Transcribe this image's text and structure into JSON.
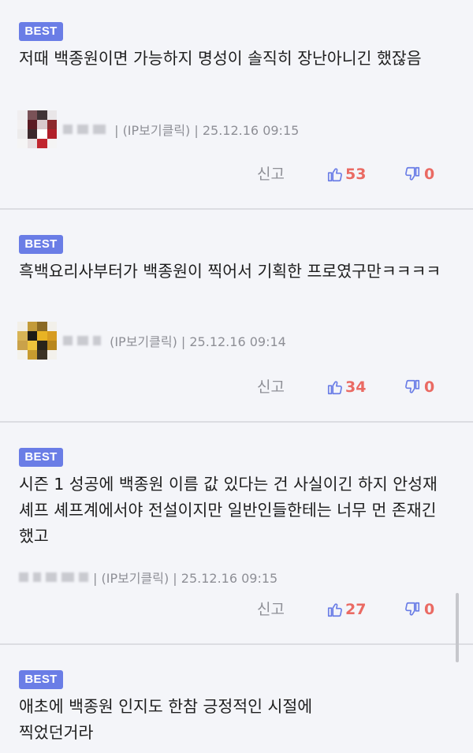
{
  "comments": [
    {
      "badge": "BEST",
      "text": "저때 백종원이면 가능하지 명성이 솔직히 장난아니긴 했잖음",
      "meta": " | (IP보기클릭) | 25.12.16 09:15",
      "report": "신고",
      "likes": "53",
      "dislikes": "0"
    },
    {
      "badge": "BEST",
      "text": "흑백요리사부터가 백종원이 찍어서 기획한 프로였구만ㅋㅋㅋㅋ",
      "meta": " (IP보기클릭) | 25.12.16 09:14",
      "report": "신고",
      "likes": "34",
      "dislikes": "0"
    },
    {
      "badge": "BEST",
      "text": "시즌 1 성공에 백종원 이름 값 있다는 건 사실이긴 하지 안성재 셰프 셰프계에서야 전설이지만 일반인들한테는 너무 먼 존재긴 했고",
      "meta": "| (IP보기클릭) | 25.12.16 09:15",
      "report": "신고",
      "likes": "27",
      "dislikes": "0"
    },
    {
      "badge": "BEST",
      "text": "애초에 백종원 인지도 한참 긍정적인 시절에 찍었던거라"
    }
  ],
  "icons": {
    "like": "thumbs-up-icon",
    "dislike": "thumbs-down-icon"
  },
  "colors": {
    "badge": "#6a7de6",
    "count": "#ea6a63",
    "thumb": "#6a7de6"
  }
}
